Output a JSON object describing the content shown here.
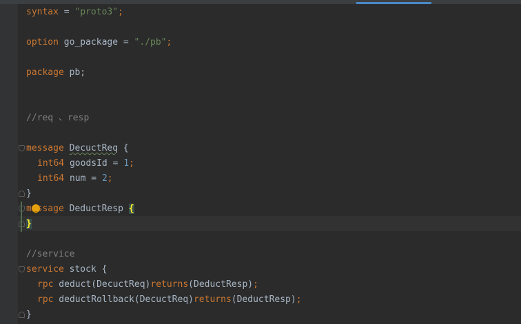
{
  "editor": {
    "lines": {
      "l1": {
        "kw": "syntax",
        "op": " = ",
        "str": "\"proto3\"",
        "end": ";"
      },
      "l3": {
        "kw": "option",
        "name": " go_package = ",
        "str": "\"./pb\"",
        "end": ";"
      },
      "l5": {
        "kw": "package",
        "name": " pb;"
      },
      "l8": {
        "comment": "//req 、resp"
      },
      "l10": {
        "kw": "message",
        "sp": " ",
        "name": "DecuctReq",
        "rest": " {"
      },
      "l11": {
        "type": "int64",
        "rest": " goodsId = ",
        "num": "1",
        "end": ";"
      },
      "l12": {
        "type": "int64",
        "rest": " num = ",
        "num": "2",
        "end": ";"
      },
      "l13": {
        "text": "}"
      },
      "l14": {
        "kw": "message",
        "name": " DeductResp ",
        "brace": "{"
      },
      "l15": {
        "brace": "}"
      },
      "l17": {
        "comment": "//service"
      },
      "l18": {
        "kw": "service",
        "name": " stock {"
      },
      "l19": {
        "kw": "rpc",
        "call": " deduct(DecuctReq)",
        "kw2": "returns",
        "ret": "(DeductResp)",
        "end": ";"
      },
      "l20": {
        "kw": "rpc",
        "call": " deductRollback(DecuctReq)",
        "kw2": "returns",
        "ret": "(DeductResp)",
        "end": ";"
      },
      "l21": {
        "text": "}"
      }
    },
    "fold_marker_start": "−",
    "fold_marker_end": "−"
  },
  "colors": {
    "background": "#2b2b2b",
    "keyword": "#cc7832",
    "string": "#6a8759",
    "number": "#6897bb",
    "comment": "#808080",
    "text": "#a9b7c6",
    "brace_highlight": "#ffef28"
  },
  "icons": [
    "fold-start-icon",
    "fold-end-icon",
    "intention-bulb-icon"
  ]
}
